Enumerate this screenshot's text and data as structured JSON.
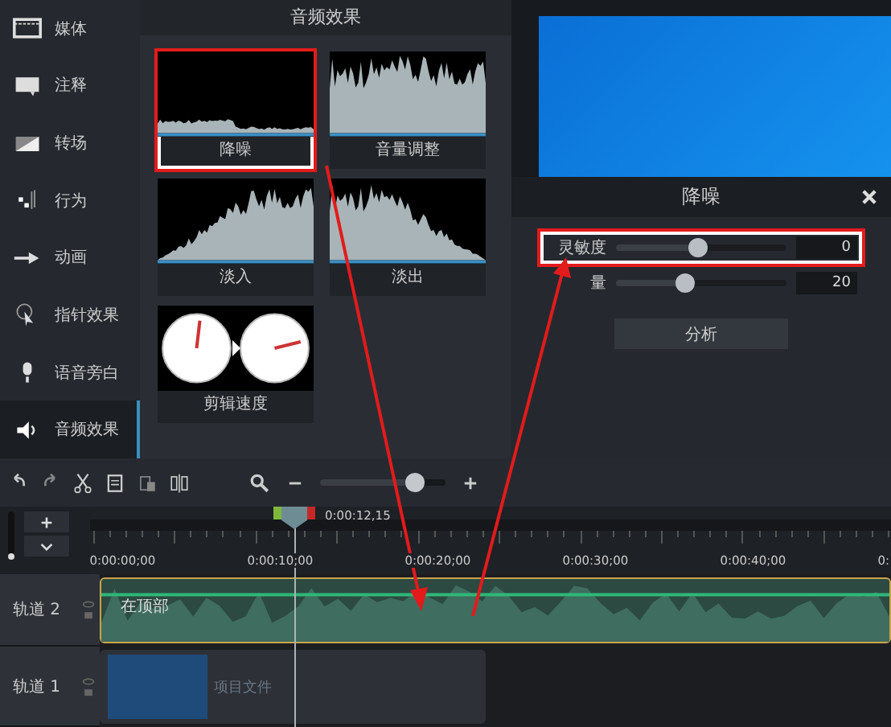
{
  "sidebar": {
    "items": [
      {
        "label": "媒体",
        "kind": "film",
        "selected": false
      },
      {
        "label": "注释",
        "kind": "callout",
        "selected": false
      },
      {
        "label": "转场",
        "kind": "transition",
        "selected": false
      },
      {
        "label": "行为",
        "kind": "behavior",
        "selected": false
      },
      {
        "label": "动画",
        "kind": "animation",
        "selected": false
      },
      {
        "label": "指针效果",
        "kind": "cursor",
        "selected": false
      },
      {
        "label": "语音旁白",
        "kind": "mic",
        "selected": false
      },
      {
        "label": "音频效果",
        "kind": "speaker",
        "selected": true
      }
    ]
  },
  "effects_panel": {
    "title": "音频效果",
    "items": [
      {
        "label": "降噪",
        "kind": "noise",
        "highlighted": true
      },
      {
        "label": "音量调整",
        "kind": "volume",
        "highlighted": false
      },
      {
        "label": "淡入",
        "kind": "fade_in",
        "highlighted": false
      },
      {
        "label": "淡出",
        "kind": "fade_out",
        "highlighted": false
      },
      {
        "label": "剪辑速度",
        "kind": "speed",
        "highlighted": false
      }
    ]
  },
  "properties": {
    "title": "降噪",
    "params": [
      {
        "label": "灵敏度",
        "level": 0.48,
        "value": "0",
        "highlighted": true
      },
      {
        "label": "量",
        "level": 0.41,
        "value": "20",
        "highlighted": false
      }
    ],
    "button": "分析"
  },
  "toolbar": {
    "zoom": {
      "level": 0.75
    }
  },
  "timeline": {
    "vertical_slider": {
      "level": 0.15
    },
    "playhead_time": "0:00:12,15",
    "ruler_labels": [
      "0:00:00;00",
      "0:00:10;00",
      "0:00:20;00",
      "0:00:30;00",
      "0:00:40;00",
      "0:"
    ],
    "tracks": [
      {
        "name": "轨道 2",
        "selected": true,
        "clip": {
          "label": "在顶部",
          "kind": "audio"
        }
      },
      {
        "name": "轨道 1",
        "selected": false,
        "clip": {
          "label": "项目文件",
          "kind": "media"
        }
      }
    ]
  }
}
